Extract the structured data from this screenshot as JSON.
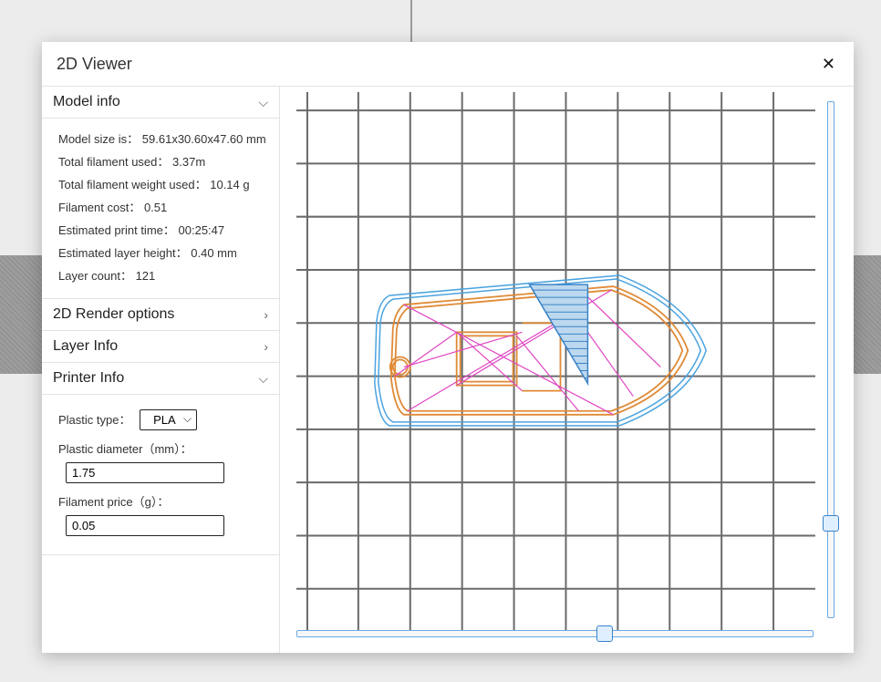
{
  "dialog": {
    "title": "2D Viewer",
    "close_glyph": "✕"
  },
  "model_info": {
    "header": "Model info",
    "size_key": "Model size is",
    "size_val": "59.61x30.60x47.60 mm",
    "filament_key": "Total filament used",
    "filament_val": "3.37m",
    "weight_key": "Total filament weight used",
    "weight_val": "10.14 g",
    "cost_key": "Filament cost",
    "cost_val": "0.51",
    "time_key": "Estimated print time",
    "time_val": "00:25:47",
    "layer_height_key": "Estimated layer height",
    "layer_height_val": "0.40 mm",
    "layer_count_key": "Layer count",
    "layer_count_val": "121"
  },
  "render_options": {
    "header": "2D Render options"
  },
  "layer_info": {
    "header": "Layer Info"
  },
  "printer_info": {
    "header": "Printer Info",
    "plastic_type_label": "Plastic type：",
    "plastic_type_value": "PLA",
    "diameter_label": "Plastic diameter（mm）：",
    "diameter_value": "1.75",
    "price_label": "Filament price（g）：",
    "price_value": "0.05"
  }
}
